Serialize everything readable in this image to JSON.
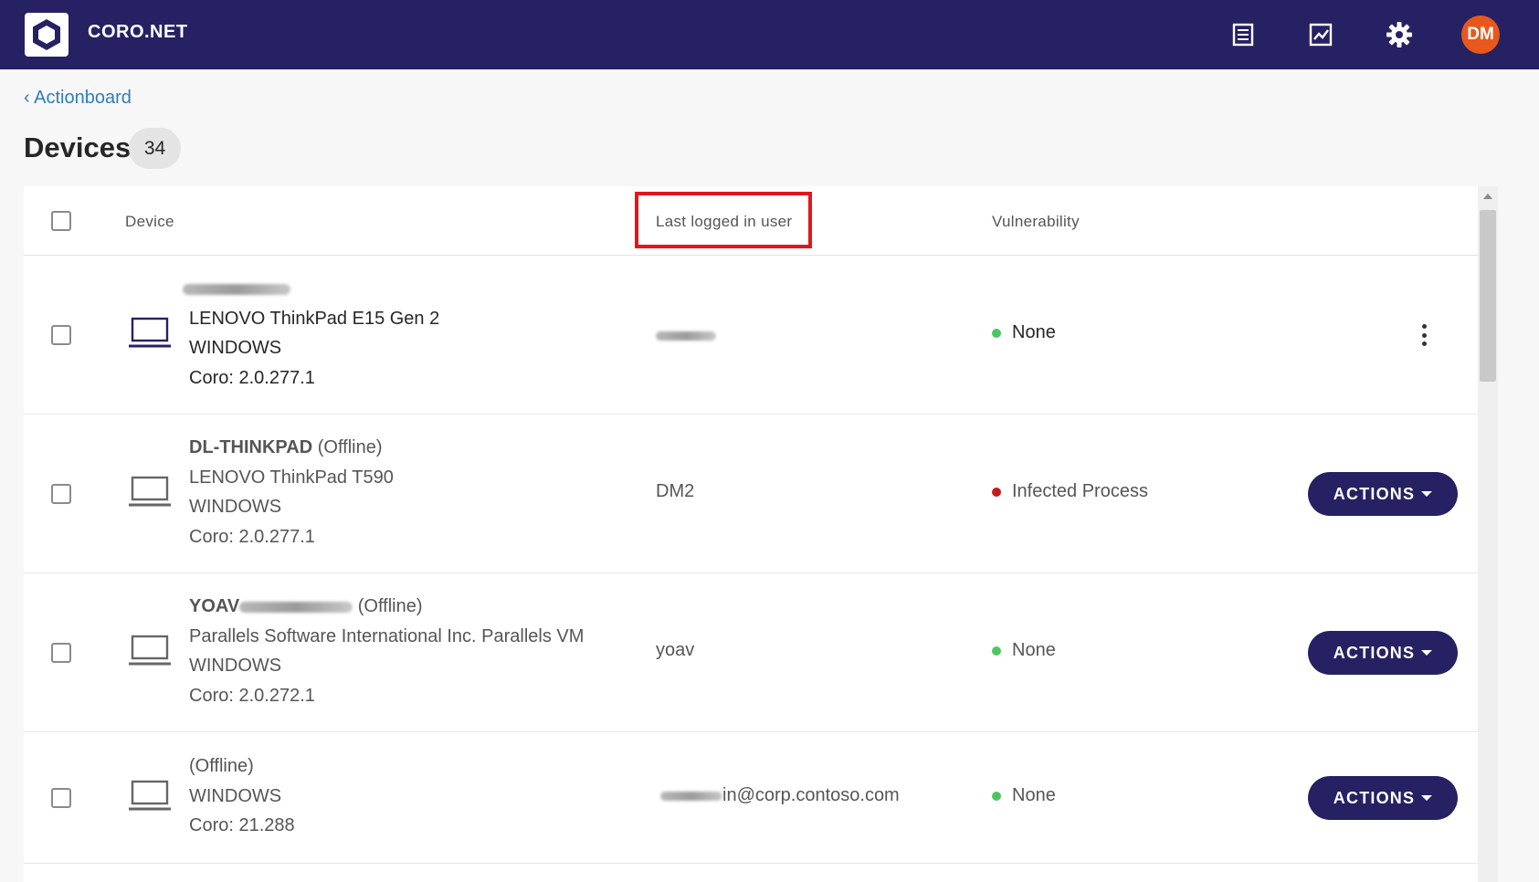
{
  "app": {
    "brand": "CORO.NET",
    "user_initials": "DM",
    "icons": [
      "logo-hexagon-icon",
      "list-icon",
      "chart-icon",
      "gear-icon"
    ],
    "colors": {
      "topbar": "#262163",
      "avatar": "#e8581c",
      "link": "#2d7fb8",
      "ok": "#4cc760",
      "danger": "#c81a1a"
    }
  },
  "breadcrumb": {
    "label": "‹ Actionboard"
  },
  "page": {
    "title": "Devices",
    "count": "34"
  },
  "table": {
    "columns": {
      "device": "Device",
      "user": "Last logged in user",
      "vulnerability": "Vulnerability"
    },
    "rows": [
      {
        "name": "",
        "status": "",
        "model": "LENOVO ThinkPad E15 Gen 2",
        "os": "WINDOWS",
        "agent": "Coro: 2.0.277.1",
        "user": "",
        "vulnerability": "None"
      },
      {
        "name": "DL-THINKPAD",
        "status": "(Offline)",
        "model": "LENOVO ThinkPad T590",
        "os": "WINDOWS",
        "agent": "Coro: 2.0.277.1",
        "user": "DM2",
        "vulnerability": "Infected Process",
        "action": "ACTIONS"
      },
      {
        "name": "YOAV",
        "status": "(Offline)",
        "model": "Parallels Software International Inc. Parallels VM",
        "os": "WINDOWS",
        "agent": "Coro: 2.0.272.1",
        "user": "yoav",
        "vulnerability": "None",
        "action": "ACTIONS"
      },
      {
        "name": "",
        "status": "(Offline)",
        "os": "WINDOWS",
        "agent": "Coro: 21.288",
        "user": "in@corp.contoso.com",
        "vulnerability": "None",
        "action": "ACTIONS"
      }
    ]
  }
}
